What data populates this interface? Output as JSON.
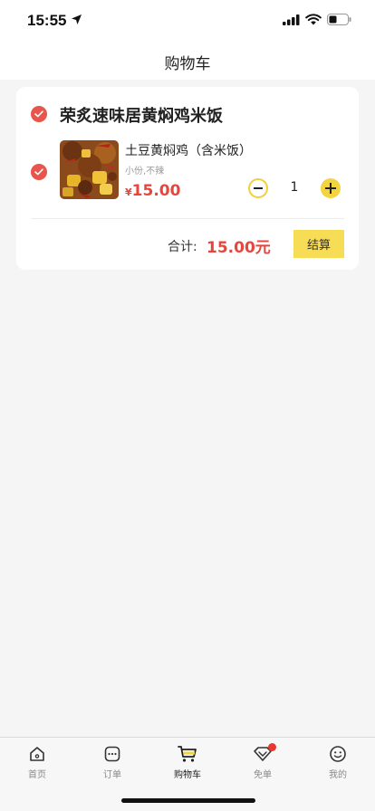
{
  "status_bar": {
    "time": "15:55"
  },
  "nav": {
    "title": "购物车"
  },
  "cart": {
    "shop_name": "荣炙速味居黄焖鸡米饭",
    "item": {
      "name": "土豆黄焖鸡（含米饭）",
      "spec": "小份,不辣",
      "currency": "¥",
      "price": "15.00",
      "quantity": "1",
      "image_icon": "braised-chicken-food-photo"
    },
    "total_label": "合计:",
    "total_value": "15.00元",
    "checkout_label": "结算"
  },
  "tabs": [
    {
      "label": "首页",
      "icon": "home-icon"
    },
    {
      "label": "订单",
      "icon": "order-icon"
    },
    {
      "label": "购物车",
      "icon": "cart-icon",
      "active": true
    },
    {
      "label": "免单",
      "icon": "free-order-icon",
      "badge": true
    },
    {
      "label": "我的",
      "icon": "profile-icon"
    }
  ],
  "colors": {
    "accent_red": "#e8453c",
    "check_red": "#e8554d",
    "accent_yellow": "#f4d43e",
    "background": "#f5f5f5"
  }
}
